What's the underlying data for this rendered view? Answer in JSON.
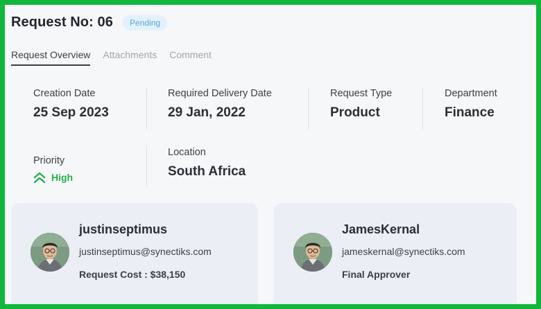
{
  "header": {
    "title": "Request No: 06",
    "status": "Pending"
  },
  "tabs": [
    {
      "label": "Request Overview",
      "active": true
    },
    {
      "label": "Attachments",
      "active": false
    },
    {
      "label": "Comment",
      "active": false
    }
  ],
  "details": {
    "creation_date": {
      "label": "Creation Date",
      "value": "25 Sep 2023"
    },
    "delivery_date": {
      "label": "Required Delivery Date",
      "value": "29 Jan, 2022"
    },
    "request_type": {
      "label": "Request Type",
      "value": "Product"
    },
    "department": {
      "label": "Department",
      "value": "Finance"
    },
    "priority": {
      "label": "Priority",
      "value": "High",
      "icon": "double-chevron-up-icon",
      "color": "#22b34a"
    },
    "location": {
      "label": "Location",
      "value": "South Africa"
    }
  },
  "people": [
    {
      "name": "justinseptimus",
      "email": "justinseptimus@synectiks.com",
      "extra": "Request Cost : $38,150"
    },
    {
      "name": "JamesKernal",
      "email": "jameskernal@synectiks.com",
      "extra": "Final Approver"
    }
  ],
  "colors": {
    "frame_border": "#12b63c",
    "badge_text": "#5aa3df",
    "badge_bg": "#e3f1fc",
    "priority_high": "#22b34a",
    "card_bg": "#ebeef5"
  }
}
